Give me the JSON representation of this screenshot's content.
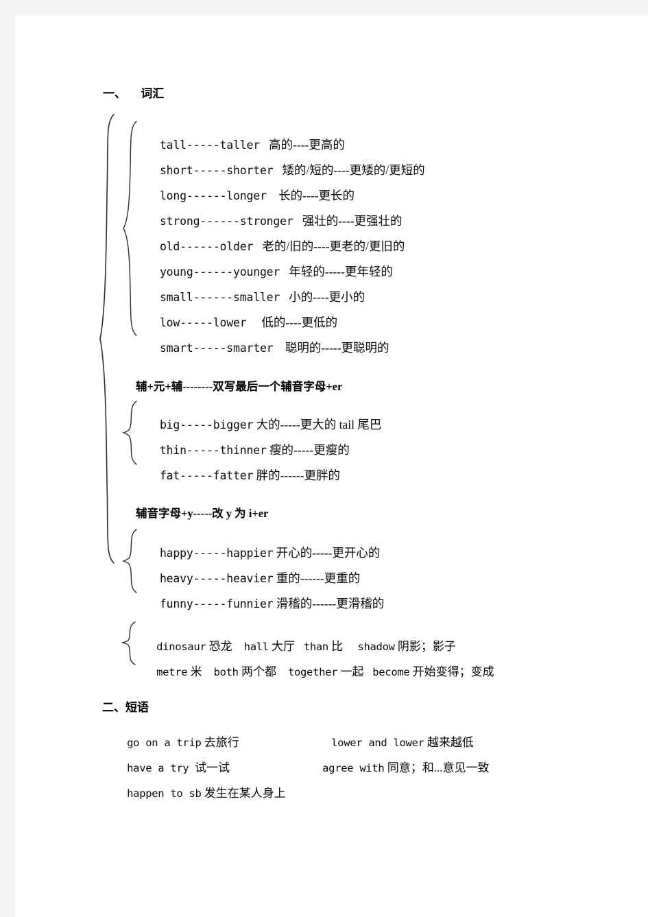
{
  "page": {
    "background": "#ffffff",
    "edge_color": "#f4f4f4",
    "text_color": "#0a0a0a"
  },
  "sections": {
    "vocab": {
      "heading": "一、     词汇"
    },
    "phrases": {
      "heading": "二、短语"
    }
  },
  "comparatives": {
    "group_regular": [
      {
        "en": "tall-----taller",
        "cn": "高的----更高的"
      },
      {
        "en": "short-----shorter",
        "cn": "矮的/短的----更矮的/更短的"
      },
      {
        "en": "long------longer",
        "cn": "长的----更长的"
      },
      {
        "en": "strong------stronger",
        "cn": "强壮的----更强壮的"
      },
      {
        "en": "old------older",
        "cn": "老的/旧的----更老的/更旧的"
      },
      {
        "en": "young------younger",
        "cn": "年轻的-----更年轻的"
      },
      {
        "en": "small------smaller",
        "cn": "小的----更小的"
      },
      {
        "en": "low-----lower",
        "cn": "低的----更低的"
      },
      {
        "en": "smart-----smarter",
        "cn": "聪明的-----更聪明的"
      }
    ],
    "rule_double": "辅+元+辅--------双写最后一个辅音字母+er",
    "group_double": [
      {
        "en": "big-----bigger",
        "cn": "大的-----更大的 tail 尾巴"
      },
      {
        "en": "thin-----thinner",
        "cn": "瘦的-----更瘦的"
      },
      {
        "en": "fat-----fatter",
        "cn": "胖的------更胖的"
      }
    ],
    "rule_y_to_i": "辅音字母+y-----改 y 为 i+er",
    "group_y_to_i": [
      {
        "en": "happy-----happier",
        "cn": "开心的-----更开心的"
      },
      {
        "en": "heavy-----heavier",
        "cn": "重的------更重的"
      },
      {
        "en": "funny-----funnier",
        "cn": "滑稽的------更滑稽的"
      }
    ]
  },
  "wordlist": {
    "row1": [
      {
        "en": "dinosaur",
        "cn": "恐龙"
      },
      {
        "en": "hall",
        "cn": "大厅"
      },
      {
        "en": "than",
        "cn": "比"
      },
      {
        "en": "shadow",
        "cn": "阴影；影子"
      }
    ],
    "row2": [
      {
        "en": "metre",
        "cn": "米"
      },
      {
        "en": "both",
        "cn": "两个都"
      },
      {
        "en": "together",
        "cn": "一起"
      },
      {
        "en": "become",
        "cn": "开始变得；变成"
      }
    ]
  },
  "phrases": {
    "left": [
      {
        "en": "go on a trip",
        "cn": "去旅行"
      },
      {
        "en": "have a try",
        "cn": "试一试"
      },
      {
        "en": "happen to sb",
        "cn": "发生在某人身上"
      }
    ],
    "right": [
      {
        "en": "lower and lower",
        "cn": "越来越低"
      },
      {
        "en": "agree with",
        "cn": "同意；和...意见一致"
      }
    ]
  }
}
